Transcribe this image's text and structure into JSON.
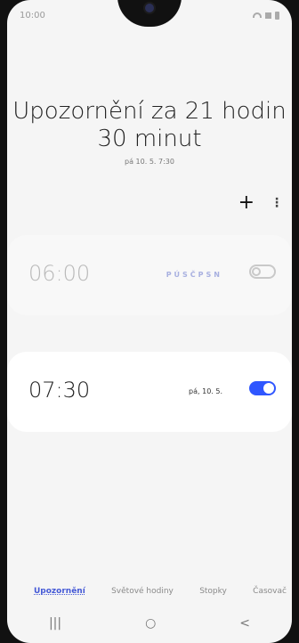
{
  "status_bar": {
    "time": "10:00"
  },
  "header": {
    "title": "Upozornění za 21 hodin 30 minut",
    "date": "pá 10. 5. 7:30"
  },
  "toolbar": {
    "plus_label": "+",
    "menu_label": "⋮"
  },
  "alarms": [
    {
      "time": "06:00",
      "days": "PÚSČPSN",
      "enabled": false
    },
    {
      "time": "07:30",
      "days": "pá, 10. 5.",
      "enabled": true
    }
  ],
  "bottom_tabs": [
    "Upozornění",
    "Světové hodiny",
    "Stopky",
    "Časovač"
  ],
  "navigation": {
    "recents": "|||",
    "home": "○",
    "back": "<"
  },
  "colors": {
    "accent": "#2f56ff",
    "active_tab": "#4459d6"
  },
  "icons": {
    "wifi": "wifi-icon",
    "battery": "battery-icon",
    "toggle_on": "toggle-on",
    "toggle_off": "toggle-off"
  }
}
